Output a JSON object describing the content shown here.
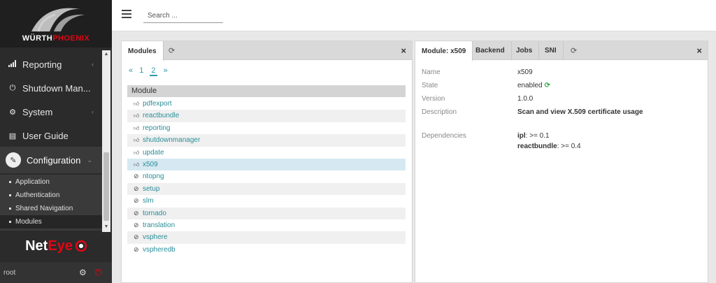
{
  "brand": {
    "logo_prefix": "WÜRTH",
    "logo_suffix": "PHOENIX",
    "product_prefix": "Net",
    "product_suffix": "Eye"
  },
  "sidebar": {
    "items": [
      {
        "label": "Reporting",
        "icon": "bar-chart-icon"
      },
      {
        "label": "Shutdown Man...",
        "icon": "power-icon"
      },
      {
        "label": "System",
        "icon": "gear-icon"
      },
      {
        "label": "User Guide",
        "icon": "book-icon"
      }
    ],
    "config_label": "Configuration",
    "subitems": [
      "Application",
      "Authentication",
      "Shared Navigation",
      "Modules"
    ],
    "active_subitem": "Modules",
    "user": "root"
  },
  "topbar": {
    "search_placeholder": "Search ..."
  },
  "left_panel": {
    "tabs": [
      "Modules"
    ],
    "pager": {
      "prev": "«",
      "pages": [
        "1",
        "2"
      ],
      "current": "2",
      "next": "»"
    },
    "column_header": "Module",
    "modules": [
      {
        "name": "pdfexport",
        "enabled": true
      },
      {
        "name": "reactbundle",
        "enabled": true
      },
      {
        "name": "reporting",
        "enabled": true
      },
      {
        "name": "shutdownmanager",
        "enabled": true
      },
      {
        "name": "update",
        "enabled": true
      },
      {
        "name": "x509",
        "enabled": true,
        "selected": true
      },
      {
        "name": "ntopng",
        "enabled": false
      },
      {
        "name": "setup",
        "enabled": false
      },
      {
        "name": "slm",
        "enabled": false
      },
      {
        "name": "tornado",
        "enabled": false
      },
      {
        "name": "translation",
        "enabled": false
      },
      {
        "name": "vsphere",
        "enabled": false
      },
      {
        "name": "vspheredb",
        "enabled": false
      }
    ]
  },
  "right_panel": {
    "tabs": [
      "Module: x509",
      "Backend",
      "Jobs",
      "SNI"
    ],
    "details": {
      "name_label": "Name",
      "name_value": "x509",
      "state_label": "State",
      "state_value": "enabled",
      "version_label": "Version",
      "version_value": "1.0.0",
      "description_label": "Description",
      "description_value": "Scan and view X.509 certificate usage",
      "dependencies_label": "Dependencies",
      "dependencies": [
        {
          "name": "ipl",
          "constraint": ": >= 0.1"
        },
        {
          "name": "reactbundle",
          "constraint": ": >= 0.4"
        }
      ]
    }
  },
  "colors": {
    "link": "#2a8e98",
    "accent_red": "#e30613",
    "selected_row": "#d6e9f2",
    "enabled_green": "#3aa84a"
  }
}
